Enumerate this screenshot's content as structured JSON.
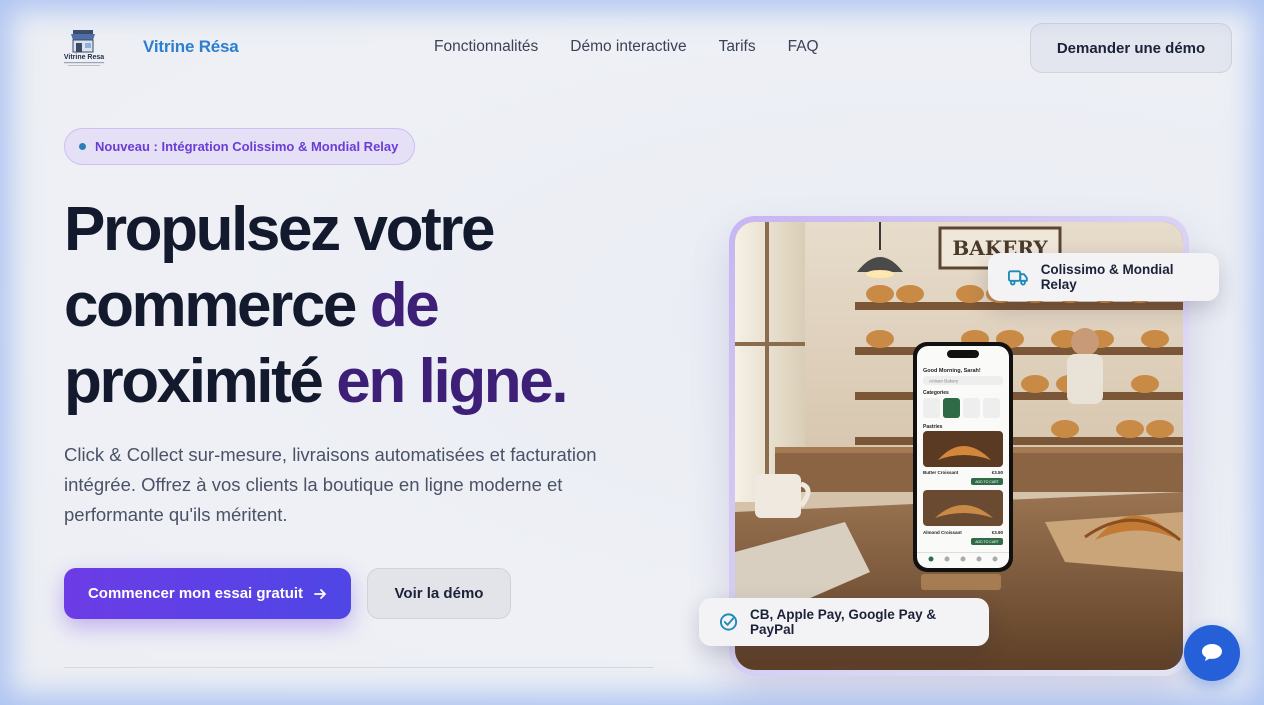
{
  "brand": {
    "name": "Vitrine Résa",
    "logo_caption": "Vitrine Resa"
  },
  "nav": {
    "items": [
      {
        "label": "Fonctionnalités"
      },
      {
        "label": "Démo interactive"
      },
      {
        "label": "Tarifs"
      },
      {
        "label": "FAQ"
      }
    ]
  },
  "header": {
    "demo_button": "Demander une démo"
  },
  "hero": {
    "badge": "Nouveau : Intégration Colissimo & Mondial Relay",
    "headline": {
      "line1": "Propulsez votre",
      "line2_a": "commerce",
      "line2_b": "de",
      "line3_a": "proximité",
      "line3_b": "en ligne."
    },
    "subtext": "Click & Collect sur-mesure, livraisons automatisées et facturation intégrée. Offrez à vos clients la boutique en ligne moderne et performante qu'ils méritent.",
    "cta_primary": "Commencer mon essai gratuit",
    "cta_secondary": "Voir la démo"
  },
  "image": {
    "sign_text": "BAKERY",
    "phone": {
      "greeting": "Good Morning, Sarah!",
      "search": "Artisan Bakery",
      "categories_title": "Categories",
      "section": "Pastries",
      "item1": "Butter Croissant",
      "item1_price": "€3.50",
      "item2": "Almond Croissant",
      "item2_price": "€3.90",
      "add": "ADD TO CART"
    }
  },
  "floating": {
    "shipping": "Colissimo & Mondial Relay",
    "payment": "CB, Apple Pay, Google Pay & PayPal"
  },
  "colors": {
    "accent": "#6c3ce6",
    "brand_blue": "#2c7fd0",
    "chat": "#2560d8"
  }
}
